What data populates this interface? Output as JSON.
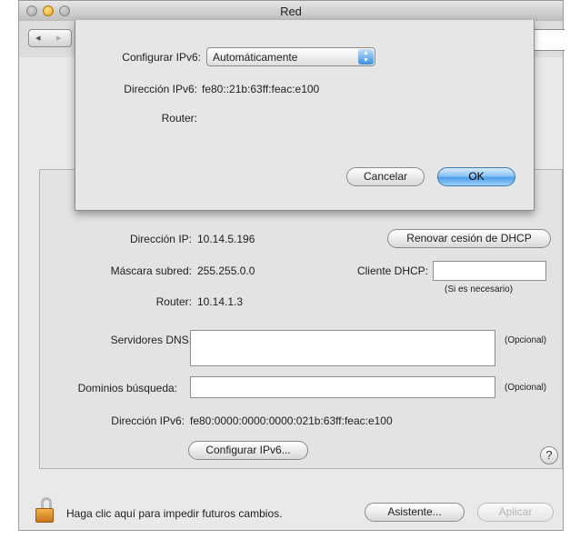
{
  "window": {
    "title": "Red"
  },
  "toolbar": {
    "back_icon": "◂",
    "forward_icon": "▸"
  },
  "form": {
    "ip_label": "Dirección IP:",
    "ip_value": "10.14.5.196",
    "renew_button": "Renovar cesión de DHCP",
    "mask_label": "Máscara subred:",
    "mask_value": "255.255.0.0",
    "dhcp_client_label": "Cliente DHCP:",
    "dhcp_client_value": "",
    "dhcp_client_hint": "(Si es necesario)",
    "router_label": "Router:",
    "router_value": "10.14.1.3",
    "dns_label": "Servidores DNS:",
    "dns_value": "",
    "dns_optional": "(Opcional)",
    "search_domains_label": "Dominios búsqueda:",
    "search_domains_value": "",
    "search_optional": "(Opcional)",
    "ipv6_label": "Dirección IPv6:",
    "ipv6_value": "fe80:0000:0000:0000:021b:63ff:feac:e100",
    "configure_ipv6_button": "Configurar IPv6...",
    "help_icon": "?"
  },
  "footer": {
    "lock_text": "Haga clic aquí para impedir futuros cambios.",
    "assistant_button": "Asistente...",
    "apply_button": "Aplicar"
  },
  "sheet": {
    "configure_label": "Configurar IPv6:",
    "configure_value": "Automáticamente",
    "address_label": "Dirección IPv6:",
    "address_value": "fe80::21b:63ff:feac:e100",
    "router_label": "Router:",
    "router_value": "",
    "cancel_button": "Cancelar",
    "ok_button": "OK"
  },
  "colors": {
    "ok_button": "#4e9ee6",
    "lock": "#e39a2e",
    "minimize": "#e3a21a"
  }
}
